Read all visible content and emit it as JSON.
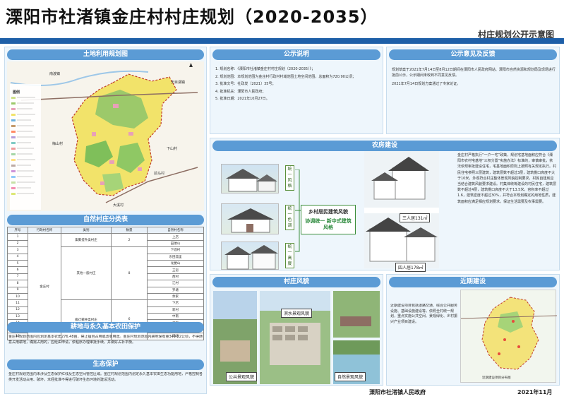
{
  "header": {
    "title": "溧阳市社渚镇金庄村村庄规划（2020-2035）",
    "subtitle": "村庄规划公开示意图"
  },
  "land_use": {
    "heading": "土地利用规划图",
    "legend_title": "图例",
    "labels": [
      "南渡镇",
      "天目湖镇",
      "梅山村",
      "下山村",
      "前马村",
      "大溪村"
    ]
  },
  "classification": {
    "heading": "自然村庄分类表",
    "columns": [
      "序号",
      "行政村名称",
      "类别",
      "数量",
      "自然村名称"
    ],
    "admin_village": "金庄村",
    "rows": [
      {
        "no": "1",
        "name": "上店"
      },
      {
        "no": "2",
        "name": "田埂山"
      },
      {
        "no": "3",
        "name": "下酒村"
      },
      {
        "no": "4",
        "name": "东田庙里"
      },
      {
        "no": "5",
        "name": "龙梗山"
      },
      {
        "no": "6",
        "name": "王窑"
      },
      {
        "no": "7",
        "name": "西村"
      },
      {
        "no": "8",
        "name": "江村"
      },
      {
        "no": "9",
        "name": "罗塘"
      },
      {
        "no": "10",
        "name": "余家"
      },
      {
        "no": "11",
        "name": "下店"
      },
      {
        "no": "12",
        "name": "新村"
      },
      {
        "no": "13",
        "name": "中南"
      },
      {
        "no": "14",
        "name": "前家"
      },
      {
        "no": "15",
        "name": "新庄"
      },
      {
        "no": "16",
        "name": "周球"
      }
    ],
    "groups": [
      {
        "type": "集聚提升类村庄",
        "count": "2"
      },
      {
        "type": "其他一般村庄",
        "count": "8"
      },
      {
        "type": "搬迁撤并类村庄",
        "count": "6"
      }
    ]
  },
  "farmland": {
    "heading": "耕地与永久基本农田保护",
    "text": "金庄村规划范围内应划定基本农田276.48亩，禁止擅自占用或改变用途。金庄村规划范围内耕地保有量349.22公顷，不得随意占用耕地，确需占用的，应经由申请，依程序办理审批手续，并做好占补平衡。"
  },
  "ecology": {
    "heading": "生态保护",
    "text": "金庄村规划范围内未涉及生态保护红线及生态空间管控区域。金庄村规划范围内划定永久基本农田生态功能用地，严格控制各类开发活动占用、破坏，未经批准不得进行破坏生态环境的建设活动。"
  },
  "notice": {
    "heading": "公示说明",
    "items": [
      "1. 规划名称：《溧阳市社渚镇金庄村村庄规划（2020-2035）》；",
      "2. 规划范围：本规划范围为金庄村行政村村域范围土地空间范围，总面积为720.90公顷；",
      "3. 批准文号：社政发〔2021〕35号；",
      "4. 批准机关：溧阳市人民政府；",
      "5. 批准日期：2021年10月27日。"
    ]
  },
  "feedback": {
    "heading": "公示意见及反馈",
    "paragraphs": [
      "规划草案于2021年7月14日至8月12日期间在溧阳市人民政府网站、溧阳市自然资源和规划局及现场进行批前公示，公示期间未收到不同意见反馈。",
      "2021年7月14日规划方案通过了专家论证。"
    ]
  },
  "housing": {
    "heading": "农房建设",
    "tags": [
      "统一风格",
      "统一色调",
      "统一高度"
    ],
    "callout_title": "乡村居民建筑风貌",
    "callout_sub": "协调统一 新中式建筑风格",
    "caption_three": "三人居131㎡",
    "caption_four": "四人居178㎡",
    "text": "金庄村严格执行“一户一宅”政策，规划宅基地面积应符合《溧阳市农村宅基地“三权分置”实施办法》标准的，审慎审批，依法依规审批建设住宅，宅基地面积原则上按照有关规定执行。村民住宅参照三层建筑，建筑层数不超过3层，建筑檐口高度不大于10米，外观符合村庄整体景观风貌控制要求，村民自建房应当结合建筑风貌要求建设。村集体统筹建设的村民住宅，建筑层数不超过4层，建筑檐口高度不大于13.5米，容积率不超过1.6，建筑密度不超过30%，并符合本规划确定的用地性质，建筑面积应满足相应规划要求，保证生活需要及农事需要。"
  },
  "landscape": {
    "heading": "村庄风貌",
    "captions": [
      "滨水景观风貌",
      "公共景观风貌",
      "自然景观风貌"
    ]
  },
  "recent": {
    "heading": "近期建设",
    "text": "近期建设项目包括道路交通、综合公共服务设施、基础设施建设等。依照全村统一规划，重点实施公共空间、景观绿化、乡村振兴产业项目建设。",
    "map_note": "近期建设项目分布图"
  },
  "footer": {
    "org": "溧阳市社渚镇人民政府",
    "date": "2021年11月"
  },
  "colors": {
    "accent": "#5b9bd5",
    "header_bar": "#1e5fa8",
    "panel_bg": "#eef6fc",
    "green": "#3b8e3b"
  }
}
